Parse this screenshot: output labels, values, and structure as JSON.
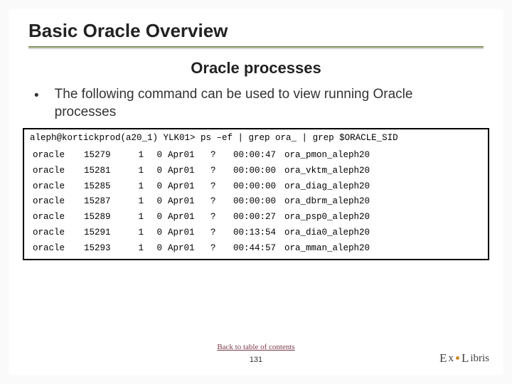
{
  "header": {
    "title": "Basic Oracle Overview",
    "subtitle": "Oracle processes"
  },
  "body": {
    "bullet": "The following command can be used to view running Oracle processes"
  },
  "terminal": {
    "command": "aleph@kortickprod(a20_1) YLK01> ps –ef | grep ora_ | grep $ORACLE_SID",
    "rows": [
      {
        "user": "oracle",
        "pid": "15279",
        "ppid": "1",
        "c": "0",
        "date": "Apr01",
        "tty": "?",
        "time": "00:00:47",
        "cmd": "ora_pmon_aleph20"
      },
      {
        "user": "oracle",
        "pid": "15281",
        "ppid": "1",
        "c": "0",
        "date": "Apr01",
        "tty": "?",
        "time": "00:00:00",
        "cmd": "ora_vktm_aleph20"
      },
      {
        "user": "oracle",
        "pid": "15285",
        "ppid": "1",
        "c": "0",
        "date": "Apr01",
        "tty": "?",
        "time": "00:00:00",
        "cmd": "ora_diag_aleph20"
      },
      {
        "user": "oracle",
        "pid": "15287",
        "ppid": "1",
        "c": "0",
        "date": "Apr01",
        "tty": "?",
        "time": "00:00:00",
        "cmd": "ora_dbrm_aleph20"
      },
      {
        "user": "oracle",
        "pid": "15289",
        "ppid": "1",
        "c": "0",
        "date": "Apr01",
        "tty": "?",
        "time": "00:00:27",
        "cmd": "ora_psp0_aleph20"
      },
      {
        "user": "oracle",
        "pid": "15291",
        "ppid": "1",
        "c": "0",
        "date": "Apr01",
        "tty": "?",
        "time": "00:13:54",
        "cmd": "ora_dia0_aleph20"
      },
      {
        "user": "oracle",
        "pid": "15293",
        "ppid": "1",
        "c": "0",
        "date": "Apr01",
        "tty": "?",
        "time": "00:44:57",
        "cmd": "ora_mman_aleph20"
      }
    ]
  },
  "footer": {
    "back_link": "Back to table of contents",
    "page_number": "131",
    "logo_text": "ExLibris"
  }
}
